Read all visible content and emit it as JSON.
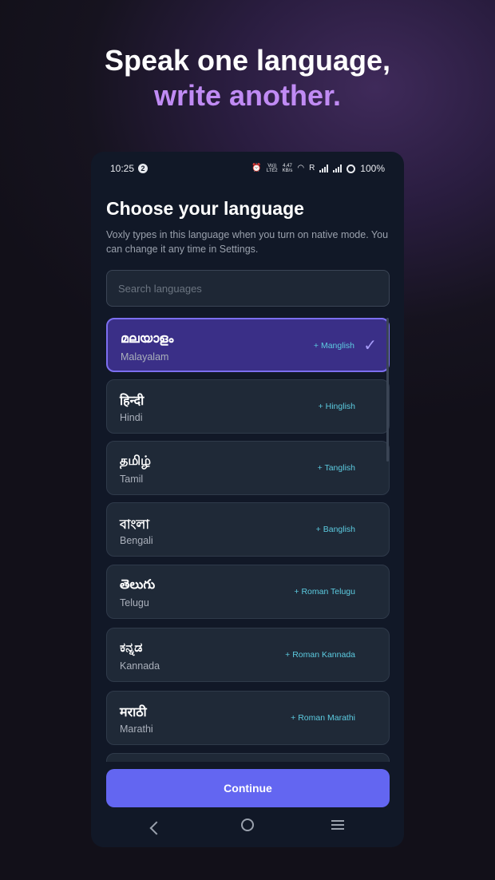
{
  "hero": {
    "line1": "Speak one language,",
    "line2": "write another."
  },
  "status_bar": {
    "time": "10:25",
    "notification_count": "2",
    "net_speed_top": "4.47",
    "net_speed_bottom": "KB/s",
    "volte_top": "Vo))",
    "volte_bottom": "LTE2",
    "roaming": "R",
    "battery": "100%"
  },
  "screen": {
    "title": "Choose your language",
    "subtitle": "Voxly types in this language when you turn on native mode. You can change it any time in Settings."
  },
  "search": {
    "placeholder": "Search languages"
  },
  "languages": [
    {
      "native": "മലയാളം",
      "english": "Malayalam",
      "tag": "+ Manglish",
      "selected": true
    },
    {
      "native": "हिन्दी",
      "english": "Hindi",
      "tag": "+ Hinglish",
      "selected": false
    },
    {
      "native": "தமிழ்",
      "english": "Tamil",
      "tag": "+ Tanglish",
      "selected": false
    },
    {
      "native": "বাংলা",
      "english": "Bengali",
      "tag": "+ Banglish",
      "selected": false
    },
    {
      "native": "తెలుగు",
      "english": "Telugu",
      "tag": "+ Roman Telugu",
      "selected": false
    },
    {
      "native": "ಕನ್ನಡ",
      "english": "Kannada",
      "tag": "+ Roman Kannada",
      "selected": false
    },
    {
      "native": "मराठी",
      "english": "Marathi",
      "tag": "+ Roman Marathi",
      "selected": false
    }
  ],
  "check_icon": "check-icon",
  "continue_label": "Continue",
  "colors": {
    "accent": "#6366f1",
    "selected_bg": "#3a2f87",
    "tag": "#5ccbe0",
    "hero_accent": "#c08bf4"
  }
}
